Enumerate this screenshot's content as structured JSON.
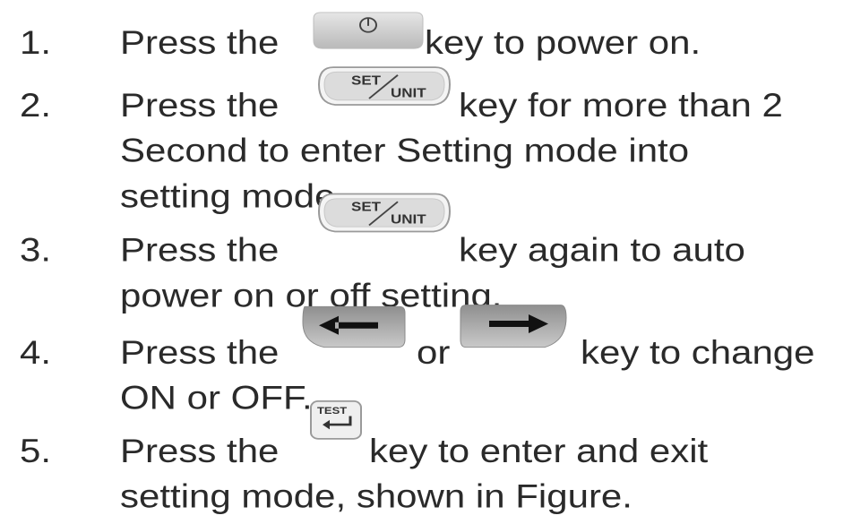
{
  "steps": [
    {
      "number": "1.",
      "before_key": "Press the",
      "key": "power-key",
      "after_key": "key to power on.",
      "lines": []
    },
    {
      "number": "2.",
      "before_key": "Press the",
      "key": "set-unit-key",
      "key_text_top": "SET",
      "key_text_bottom": "UNIT",
      "after_key": "key for more than 2",
      "lines": [
        "Second to enter Setting mode into",
        "setting mode."
      ]
    },
    {
      "number": "3.",
      "before_key": "Press the",
      "key": "set-unit-key",
      "key_text_top": "SET",
      "key_text_bottom": "UNIT",
      "after_key": "key again to auto",
      "lines": [
        "power on or off setting."
      ]
    },
    {
      "number": "4.",
      "before_key": "Press the",
      "key": "left-arrow-key",
      "between": "or",
      "key2": "right-arrow-key",
      "after_key": "key to change",
      "lines": [
        "ON or OFF."
      ]
    },
    {
      "number": "5.",
      "before_key": "Press the",
      "key": "test-enter-key",
      "key_text": "TEST",
      "after_key": "key to enter and exit",
      "lines": [
        "setting mode, shown in Figure."
      ]
    }
  ]
}
